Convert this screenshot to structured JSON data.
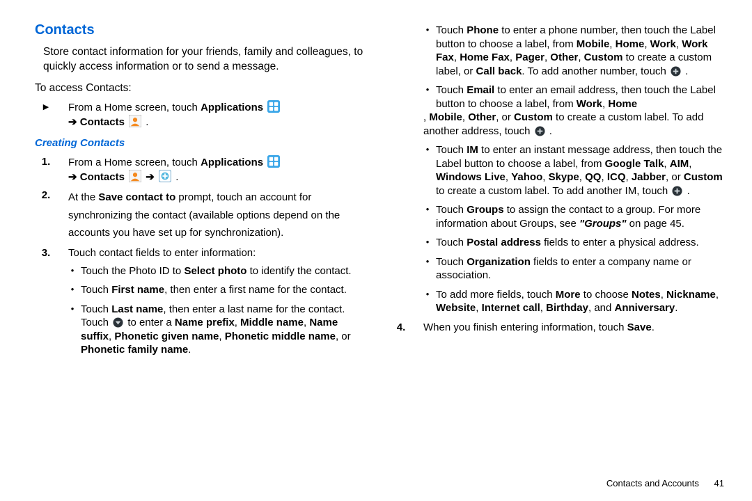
{
  "h_contacts": "Contacts",
  "intro": "Store contact information for your friends, family and colleagues, to quickly access information or to send a message.",
  "to_access": "To access Contacts:",
  "step_a_pre": "From a Home screen, touch ",
  "step_a_apps": "Applications",
  "step_a_arrow": " ➔ ",
  "step_a_contacts": "Contacts",
  "step_a_end": " .",
  "h_creating": "Creating Contacts",
  "s1_pre": "From a Home screen, touch ",
  "s1_apps": "Applications",
  "s1_arrow": " ➔ ",
  "s1_contacts": "Contacts",
  "s1_arrow2": "  ➔  ",
  "s1_end": " .",
  "s2_a": "At the ",
  "s2_b": "Save contact to",
  "s2_c": " prompt, touch an account for synchronizing the contact (available options depend on the accounts you have set up for synchronization).",
  "s3": "Touch contact fields to enter information:",
  "b_photo_a": "Touch the Photo ID to ",
  "b_photo_b": "Select photo",
  "b_photo_c": " to identify the contact.",
  "b_first_a": "Touch ",
  "b_first_b": "First name",
  "b_first_c": ", then enter a first name for the contact.",
  "b_last_a": "Touch ",
  "b_last_b": "Last name",
  "b_last_c": ", then enter a last name for the contact. Touch ",
  "b_last_d": " to enter a ",
  "b_last_e": "Name prefix",
  "b_last_f": ", ",
  "b_last_g": "Middle name",
  "b_last_h": ", ",
  "b_last_i": "Name suffix",
  "b_last_j": ", ",
  "b_last_k": "Phonetic given name",
  "b_last_l": ", ",
  "b_last_m": "Phonetic middle name",
  "b_last_n": ", or ",
  "b_last_o": "Phonetic family name",
  "b_last_p": ".",
  "r_phone_a": "Touch ",
  "r_phone_b": "Phone",
  "r_phone_c": " to enter a phone number, then touch the Label button to choose a label, from ",
  "r_phone_d": "Mobile",
  "r_phone_e": "Home",
  "r_phone_f": "Work",
  "r_phone_g": "Work Fax",
  "r_phone_h": "Home Fax",
  "r_phone_i": "Pager",
  "r_phone_j": "Other",
  "r_phone_k": "Custom",
  "r_phone_l": " to create a custom label, or ",
  "r_phone_m": "Call back",
  "r_phone_n": ". To add another number, touch ",
  "r_phone_o": " .",
  "r_email_a": "Touch ",
  "r_email_b": "Email",
  "r_email_c": " to enter an email address, then touch the Label button to choose a label, from ",
  "r_email_d": "Work",
  "r_email_e": "Home",
  "r_email_f": "Mobile",
  "r_email_g": "Other",
  "r_email_h": ", or ",
  "r_email_i": "Custom",
  "r_email_j": " to create a custom label. To add another address, touch ",
  "r_email_k": " .",
  "r_im_a": "Touch ",
  "r_im_b": "IM",
  "r_im_c": " to enter an instant message address, then touch the Label button to choose a label, from ",
  "r_im_d": "Google Talk",
  "r_im_e": "AIM",
  "r_im_f": "Windows Live",
  "r_im_g": "Yahoo",
  "r_im_h": "Skype",
  "r_im_i": "QQ",
  "r_im_j": "ICQ",
  "r_im_k": "Jabber",
  "r_im_l": ", or ",
  "r_im_m": "Custom",
  "r_im_n": " to create a custom label. To add another IM, touch ",
  "r_im_o": " .",
  "r_groups_a": "Touch ",
  "r_groups_b": "Groups",
  "r_groups_c": " to assign the contact to a group. For more information about Groups, see ",
  "r_groups_d": "\"Groups\"",
  "r_groups_e": " on page 45.",
  "r_postal_a": "Touch ",
  "r_postal_b": "Postal address",
  "r_postal_c": " fields to enter a physical address.",
  "r_org_a": "Touch ",
  "r_org_b": "Organization",
  "r_org_c": " fields to enter a company name or association.",
  "r_more_a": "To add more fields, touch ",
  "r_more_b": "More",
  "r_more_c": " to choose ",
  "r_more_d": "Notes",
  "r_more_e": "Nickname",
  "r_more_f": "Website",
  "r_more_g": "Internet call",
  "r_more_h": "Birthday",
  "r_more_i": ", and ",
  "r_more_j": "Anniversary",
  "r_more_k": ".",
  "s4_a": "When you finish entering information, touch ",
  "s4_b": "Save",
  "s4_c": ".",
  "footer_section": "Contacts and Accounts",
  "footer_page": "41",
  "sep": ", "
}
